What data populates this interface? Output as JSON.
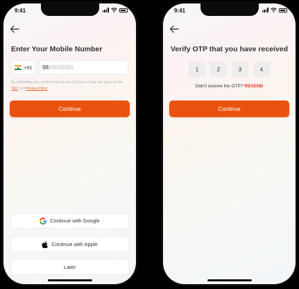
{
  "status": {
    "time": "9:41"
  },
  "login": {
    "title": "Enter Your Mobile Number",
    "country_code": "+91",
    "phone_value": "98",
    "phone_hint": "00000000",
    "consent_text": "By submitting your confirm that you are 18 years of age and agree to the",
    "tnc_link": "T&C",
    "and_text": "and",
    "privacy_link": "Privacy Policy",
    "continue_label": "Continue",
    "google_label": "Continue with Google",
    "apple_label": "Continue with Apple",
    "later_label": "Later"
  },
  "otp": {
    "title": "Verify OTP that you have received",
    "digits": [
      "1",
      "2",
      "3",
      "4"
    ],
    "resend_prompt": "Didn't receive the OTP?",
    "resend_label": "RESEND",
    "continue_label": "Continue"
  },
  "colors": {
    "accent": "#e9530f",
    "resend": "#e8332a"
  },
  "icons": [
    "back-arrow-icon",
    "india-flag-icon",
    "google-icon",
    "apple-icon",
    "signal-icon",
    "wifi-icon",
    "battery-icon"
  ]
}
